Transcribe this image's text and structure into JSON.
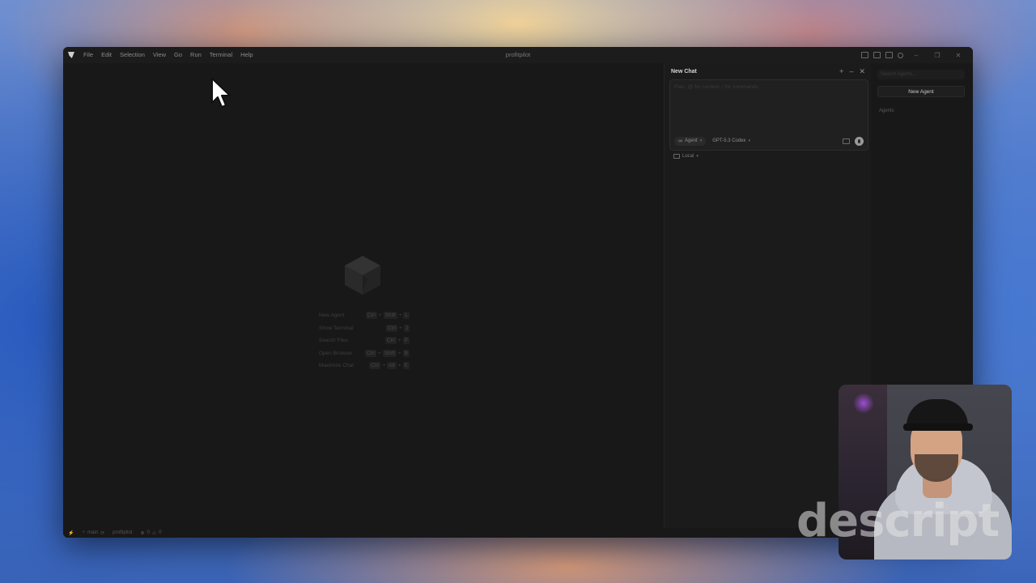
{
  "window": {
    "title": "profitpilot",
    "menu": [
      "File",
      "Edit",
      "Selection",
      "View",
      "Go",
      "Run",
      "Terminal",
      "Help"
    ]
  },
  "editor": {
    "shortcuts": [
      {
        "label": "New Agent",
        "keys": [
          "Ctrl",
          "+",
          "Shift",
          "+",
          "L"
        ]
      },
      {
        "label": "Show Terminal",
        "keys": [
          "Ctrl",
          "+",
          "J"
        ]
      },
      {
        "label": "Search Files",
        "keys": [
          "Ctrl",
          "+",
          "P"
        ]
      },
      {
        "label": "Open Browser",
        "keys": [
          "Ctrl",
          "+",
          "Shift",
          "+",
          "B"
        ]
      },
      {
        "label": "Maximize Chat",
        "keys": [
          "Ctrl",
          "+",
          "Alt",
          "+",
          "E"
        ]
      }
    ]
  },
  "chat": {
    "title": "New Chat",
    "input_placeholder": "Plan, @ for context, / for commands",
    "mode": "Agent",
    "model": "GPT-5.3 Codex",
    "environment": "Local"
  },
  "agents": {
    "search_placeholder": "Search Agents...",
    "new_agent_label": "New Agent",
    "heading": "Agents"
  },
  "statusbar": {
    "branch": "main",
    "project": "profitpilot",
    "errors": "0",
    "warnings": "0"
  },
  "watermark": "descript"
}
